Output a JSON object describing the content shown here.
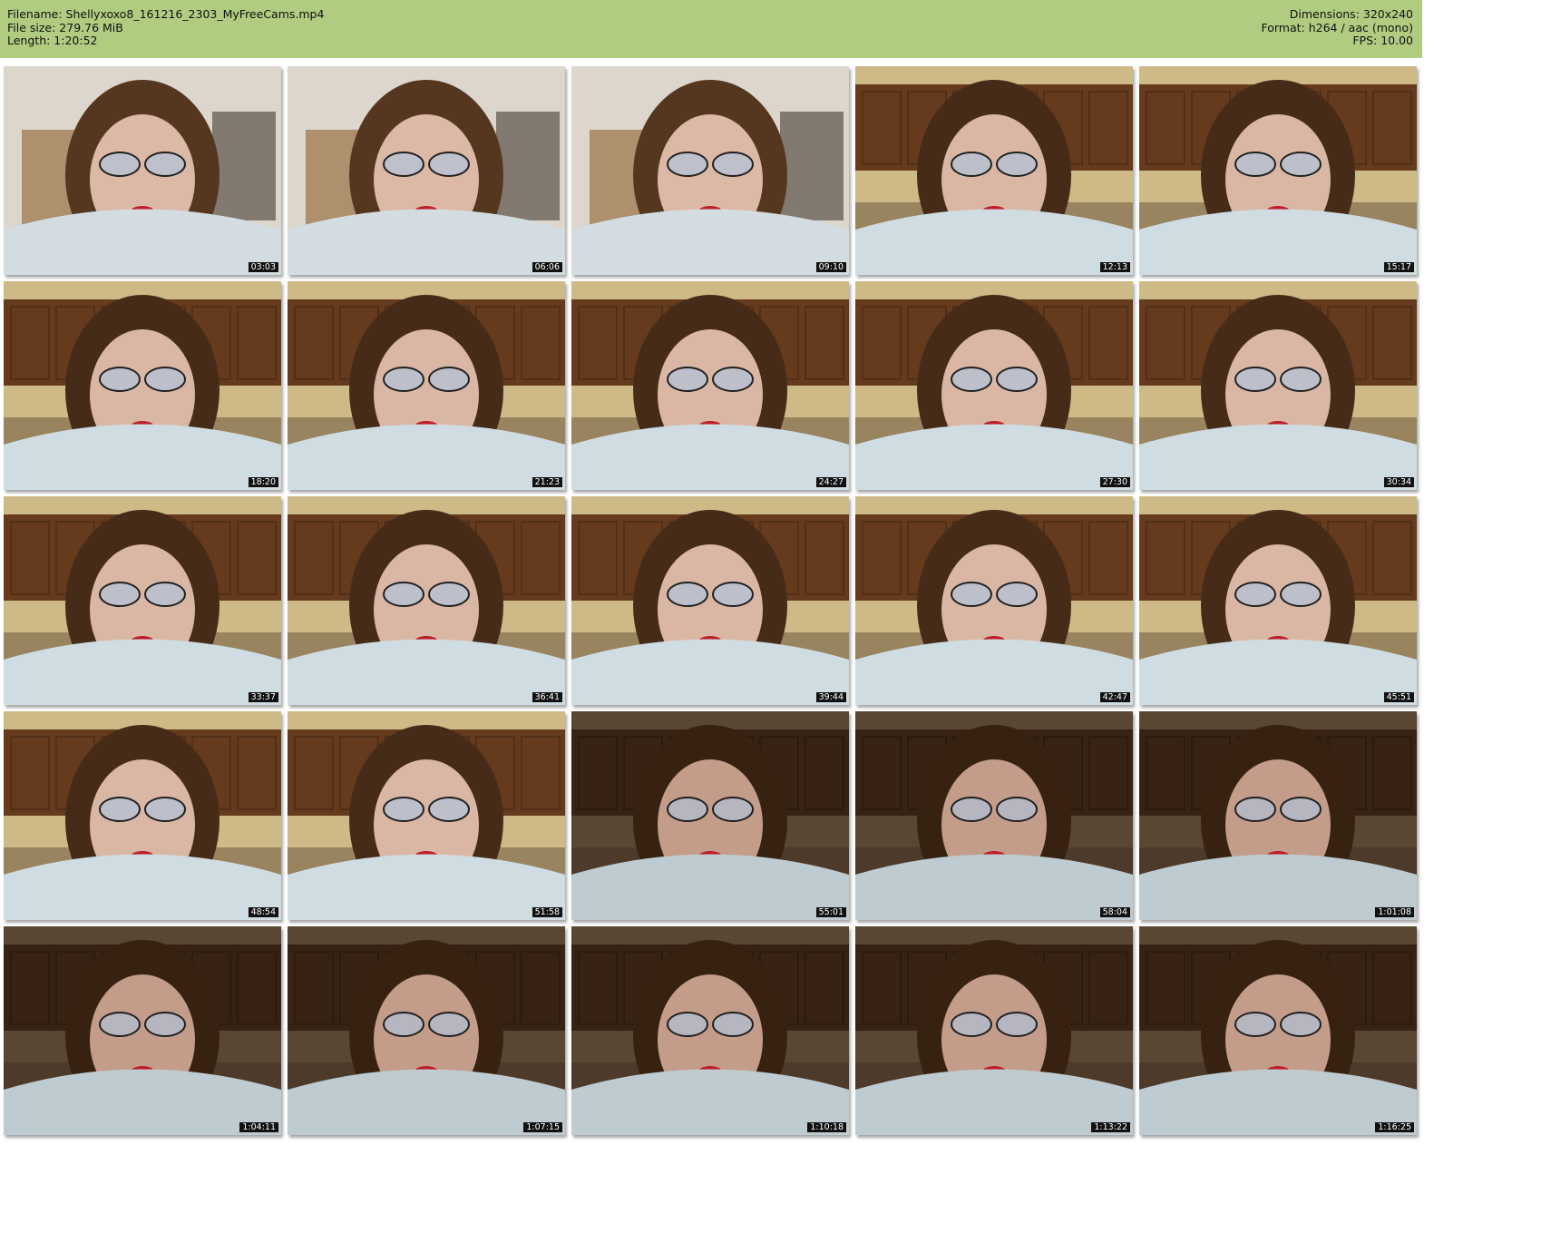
{
  "header": {
    "filename": "Filename: Shellyxoxo8_161216_2303_MyFreeCams.mp4",
    "file_size": "File size: 279.76 MiB",
    "length": "Length: 1:20:52",
    "dimensions": "Dimensions: 320x240",
    "format": "Format: h264 / aac (mono)",
    "fps": "FPS: 10.00"
  },
  "thumbnails": [
    {
      "timestamp": "03:03",
      "scene": "room"
    },
    {
      "timestamp": "06:06",
      "scene": "room"
    },
    {
      "timestamp": "09:10",
      "scene": "room"
    },
    {
      "timestamp": "12:13",
      "scene": "kitchen"
    },
    {
      "timestamp": "15:17",
      "scene": "kitchen"
    },
    {
      "timestamp": "18:20",
      "scene": "kitchen"
    },
    {
      "timestamp": "21:23",
      "scene": "kitchen"
    },
    {
      "timestamp": "24:27",
      "scene": "kitchen"
    },
    {
      "timestamp": "27:30",
      "scene": "kitchen"
    },
    {
      "timestamp": "30:34",
      "scene": "kitchen"
    },
    {
      "timestamp": "33:37",
      "scene": "kitchen"
    },
    {
      "timestamp": "36:41",
      "scene": "kitchen"
    },
    {
      "timestamp": "39:44",
      "scene": "kitchen"
    },
    {
      "timestamp": "42:47",
      "scene": "kitchen"
    },
    {
      "timestamp": "45:51",
      "scene": "kitchen"
    },
    {
      "timestamp": "48:54",
      "scene": "kitchen"
    },
    {
      "timestamp": "51:58",
      "scene": "kitchen"
    },
    {
      "timestamp": "55:01",
      "scene": "kitchen-dark"
    },
    {
      "timestamp": "58:04",
      "scene": "kitchen-dark"
    },
    {
      "timestamp": "1:01:08",
      "scene": "kitchen-dark"
    },
    {
      "timestamp": "1:04:11",
      "scene": "kitchen-dark"
    },
    {
      "timestamp": "1:07:15",
      "scene": "kitchen-dark"
    },
    {
      "timestamp": "1:10:18",
      "scene": "kitchen-dark"
    },
    {
      "timestamp": "1:13:22",
      "scene": "kitchen-dark"
    },
    {
      "timestamp": "1:16:25",
      "scene": "kitchen-dark"
    }
  ],
  "colors": {
    "header_bg": "#b0cc80",
    "timestamp_bg": "#111111",
    "timestamp_text": "#ffffff"
  }
}
